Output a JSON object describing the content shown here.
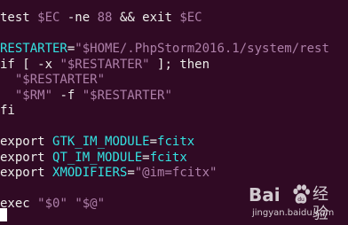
{
  "terminal": {
    "background": "#300a24",
    "colors": {
      "default": "#eeeeec",
      "string": "#ad7fa8",
      "variable": "#34e2e2"
    },
    "lines": [
      [
        {
          "t": "test ",
          "c": "w"
        },
        {
          "t": "$EC",
          "c": "p"
        },
        {
          "t": " -ne ",
          "c": "w"
        },
        {
          "t": "88",
          "c": "p"
        },
        {
          "t": " && exit ",
          "c": "w"
        },
        {
          "t": "$EC",
          "c": "p"
        }
      ],
      [],
      [
        {
          "t": "RESTARTER",
          "c": "c"
        },
        {
          "t": "=",
          "c": "w"
        },
        {
          "t": "\"$HOME/.PhpStorm2016.1/system/rest",
          "c": "p"
        }
      ],
      [
        {
          "t": "if [ -x ",
          "c": "w"
        },
        {
          "t": "\"$RESTARTER\"",
          "c": "p"
        },
        {
          "t": " ]; then",
          "c": "w"
        }
      ],
      [
        {
          "t": "  ",
          "c": "w"
        },
        {
          "t": "\"$RESTARTER\"",
          "c": "p"
        }
      ],
      [
        {
          "t": "  ",
          "c": "w"
        },
        {
          "t": "\"$RM\"",
          "c": "p"
        },
        {
          "t": " -f ",
          "c": "w"
        },
        {
          "t": "\"$RESTARTER\"",
          "c": "p"
        }
      ],
      [
        {
          "t": "fi",
          "c": "w"
        }
      ],
      [],
      [
        {
          "t": "export ",
          "c": "w"
        },
        {
          "t": "GTK_IM_MODULE",
          "c": "c"
        },
        {
          "t": "=",
          "c": "w"
        },
        {
          "t": "fcitx",
          "c": "c"
        }
      ],
      [
        {
          "t": "export ",
          "c": "w"
        },
        {
          "t": "QT_IM_MODULE",
          "c": "c"
        },
        {
          "t": "=",
          "c": "w"
        },
        {
          "t": "fcitx",
          "c": "c"
        }
      ],
      [
        {
          "t": "export ",
          "c": "w"
        },
        {
          "t": "XMODIFIERS",
          "c": "c"
        },
        {
          "t": "=",
          "c": "w"
        },
        {
          "t": "\"@im=fcitx\"",
          "c": "p"
        }
      ],
      [],
      [
        {
          "t": "exec ",
          "c": "w"
        },
        {
          "t": "\"$0\"",
          "c": "p"
        },
        {
          "t": " ",
          "c": "w"
        },
        {
          "t": "\"$@\"",
          "c": "p"
        }
      ]
    ]
  },
  "watermark": {
    "brand_part1": "Bai",
    "paw_icon": "baidu-paw-icon",
    "brand_part2": "经验",
    "url": "jingyan.baidu.com"
  }
}
